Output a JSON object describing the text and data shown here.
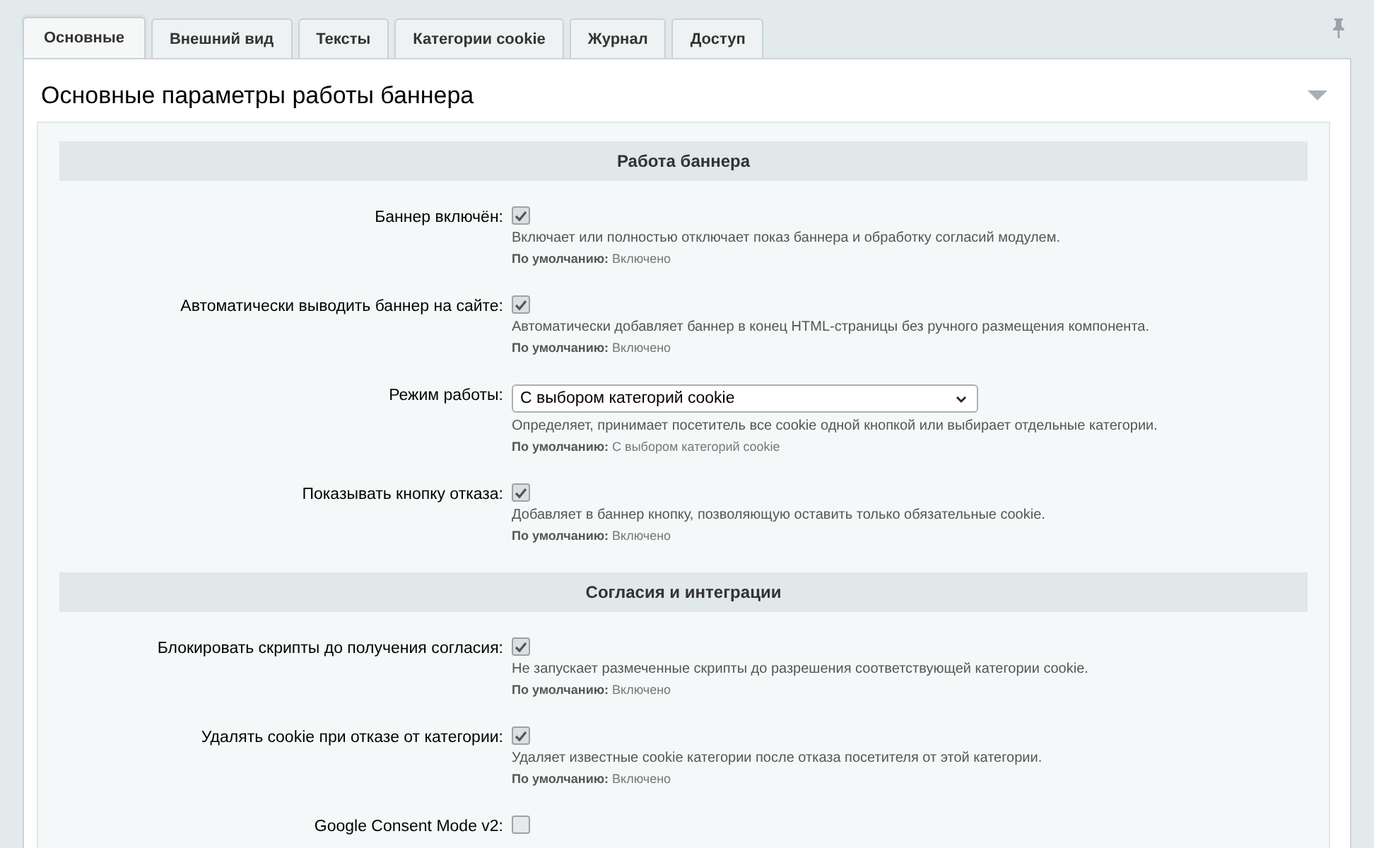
{
  "tabs": [
    {
      "label": "Основные",
      "selected": true
    },
    {
      "label": "Внешний вид",
      "selected": false
    },
    {
      "label": "Тексты",
      "selected": false
    },
    {
      "label": "Категории cookie",
      "selected": false
    },
    {
      "label": "Журнал",
      "selected": false
    },
    {
      "label": "Доступ",
      "selected": false
    }
  ],
  "panel": {
    "title": "Основные параметры работы баннера"
  },
  "sections": [
    {
      "title": "Работа баннера",
      "rows": [
        {
          "kind": "checkbox",
          "label": "Баннер включён:",
          "checked": true,
          "description": "Включает или полностью отключает показ баннера и обработку согласий модулем.",
          "default_label": "По умолчанию:",
          "default_value": "Включено"
        },
        {
          "kind": "checkbox",
          "label": "Автоматически выводить баннер на сайте:",
          "checked": true,
          "description": "Автоматически добавляет баннер в конец HTML-страницы без ручного размещения компонента.",
          "default_label": "По умолчанию:",
          "default_value": "Включено"
        },
        {
          "kind": "select",
          "label": "Режим работы:",
          "value": "С выбором категорий cookie",
          "description": "Определяет, принимает посетитель все cookie одной кнопкой или выбирает отдельные категории.",
          "default_label": "По умолчанию:",
          "default_value": "С выбором категорий cookie"
        },
        {
          "kind": "checkbox",
          "label": "Показывать кнопку отказа:",
          "checked": true,
          "description": "Добавляет в баннер кнопку, позволяющую оставить только обязательные cookie.",
          "default_label": "По умолчанию:",
          "default_value": "Включено"
        }
      ]
    },
    {
      "title": "Согласия и интеграции",
      "rows": [
        {
          "kind": "checkbox",
          "label": "Блокировать скрипты до получения согласия:",
          "checked": true,
          "description": "Не запускает размеченные скрипты до разрешения соответствующей категории cookie.",
          "default_label": "По умолчанию:",
          "default_value": "Включено"
        },
        {
          "kind": "checkbox",
          "label": "Удалять cookie при отказе от категории:",
          "checked": true,
          "description": "Удаляет известные cookie категории после отказа посетителя от этой категории.",
          "default_label": "По умолчанию:",
          "default_value": "Включено"
        },
        {
          "kind": "checkbox",
          "label": "Google Consent Mode v2:",
          "checked": false
        }
      ]
    }
  ]
}
